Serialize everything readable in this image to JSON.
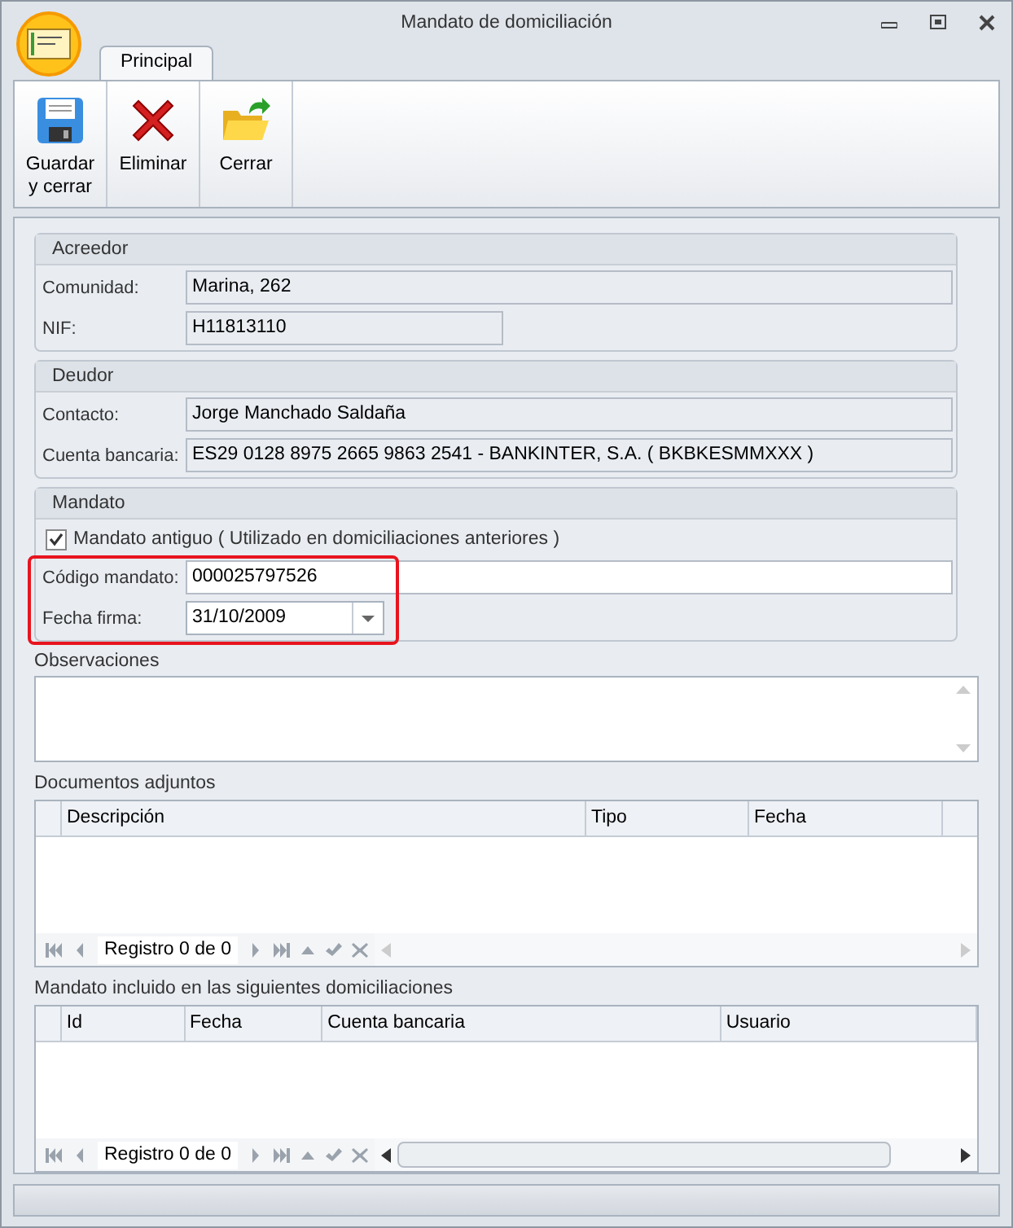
{
  "window": {
    "title": "Mandato de domiciliación"
  },
  "tabs": [
    {
      "label": "Principal",
      "selected": true
    }
  ],
  "ribbon": [
    {
      "kind": "save",
      "label": "Guardar\ny cerrar"
    },
    {
      "kind": "delete",
      "label": "Eliminar"
    },
    {
      "kind": "close",
      "label": "Cerrar"
    }
  ],
  "groups": [
    {
      "title": "Acreedor",
      "fields": [
        {
          "label": "Comunidad:",
          "value": "Marina, 262",
          "readonly": true,
          "kind": "text"
        },
        {
          "label": "NIF:",
          "value": "H11813110",
          "readonly": true,
          "kind": "short_text"
        }
      ]
    },
    {
      "title": "Deudor",
      "fields": [
        {
          "label": "Contacto:",
          "value": "Jorge Manchado Saldaña",
          "readonly": true,
          "kind": "text"
        },
        {
          "label": "Cuenta bancaria:",
          "value": "ES29 0128 8975 2665 9863 2541 - BANKINTER, S.A. ( BKBKESMMXXX )",
          "readonly": true,
          "kind": "text"
        }
      ]
    },
    {
      "title": "Mandato",
      "checkbox": {
        "label": "Mandato antiguo ( Utilizado en domiciliaciones anteriores )",
        "checked": true
      },
      "highlighted": true,
      "fields": [
        {
          "label": "Código mandato:",
          "value": "000025797526",
          "readonly": false,
          "kind": "text"
        },
        {
          "label": "Fecha firma:",
          "value": "31/10/2009",
          "readonly": false,
          "kind": "combo"
        }
      ]
    }
  ],
  "observations": {
    "label": "Observaciones"
  },
  "grids": [
    {
      "title": "Documentos adjuntos",
      "columns": [
        "Descripción",
        "Tipo",
        "Fecha"
      ],
      "navigator": "Registro 0 de 0",
      "hscroll_thumb": false
    },
    {
      "title": "Mandato incluido en las siguientes domiciliaciones",
      "columns": [
        "Id",
        "Fecha",
        "Cuenta bancaria",
        "Usuario"
      ],
      "navigator": "Registro 0 de 0",
      "hscroll_thumb": true
    }
  ]
}
